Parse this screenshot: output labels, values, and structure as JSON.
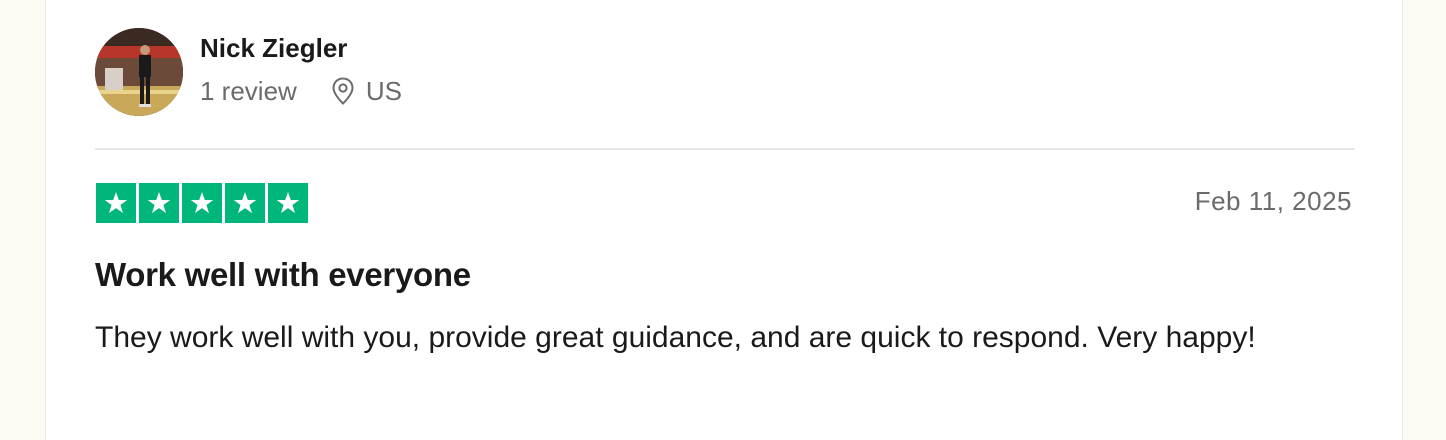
{
  "reviewer": {
    "name": "Nick Ziegler",
    "review_count": "1 review",
    "location": "US",
    "avatar_icon": "profile-photo"
  },
  "review": {
    "rating": 5,
    "rating_max": 5,
    "star_color": "#00b67a",
    "date": "Feb 11, 2025",
    "title": "Work well with everyone",
    "body": "They work well with you, provide great guidance, and are quick to respond. Very happy!"
  }
}
